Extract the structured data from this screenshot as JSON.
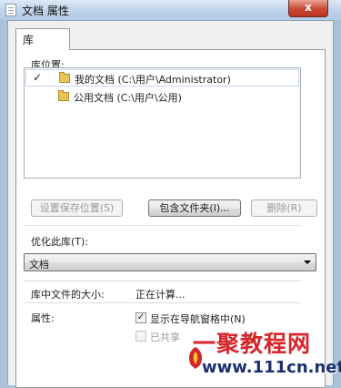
{
  "window": {
    "title": "文档 属性",
    "close_glyph": "x"
  },
  "tabs": [
    {
      "label": "库"
    }
  ],
  "library_locations": {
    "label": "库位置:",
    "items": [
      {
        "checked": true,
        "check_glyph": "✓",
        "text": "我的文档 (C:\\用户\\Administrator)"
      },
      {
        "checked": false,
        "check_glyph": "",
        "text": "公用文档 (C:\\用户\\公用)"
      }
    ]
  },
  "buttons": {
    "set_save_location": "设置保存位置(S)",
    "include_folder": "包含文件夹(I)...",
    "remove": "删除(R)"
  },
  "optimize": {
    "label": "优化此库(T):",
    "selected": "文档"
  },
  "size": {
    "label": "库中文件的大小:",
    "value": "正在计算..."
  },
  "attributes": {
    "label": "属性:",
    "show_in_nav": {
      "label": "显示在导航窗格中(N)",
      "checked": true,
      "glyph": "✓"
    },
    "shared": {
      "label": "已共享",
      "checked": false
    }
  },
  "watermark": {
    "text": "一聚教程网",
    "url": "www.111cn.net"
  },
  "colors": {
    "accent": "#d6262b",
    "url": "#1b2f6e",
    "selection_border": "#c6d9f0"
  }
}
